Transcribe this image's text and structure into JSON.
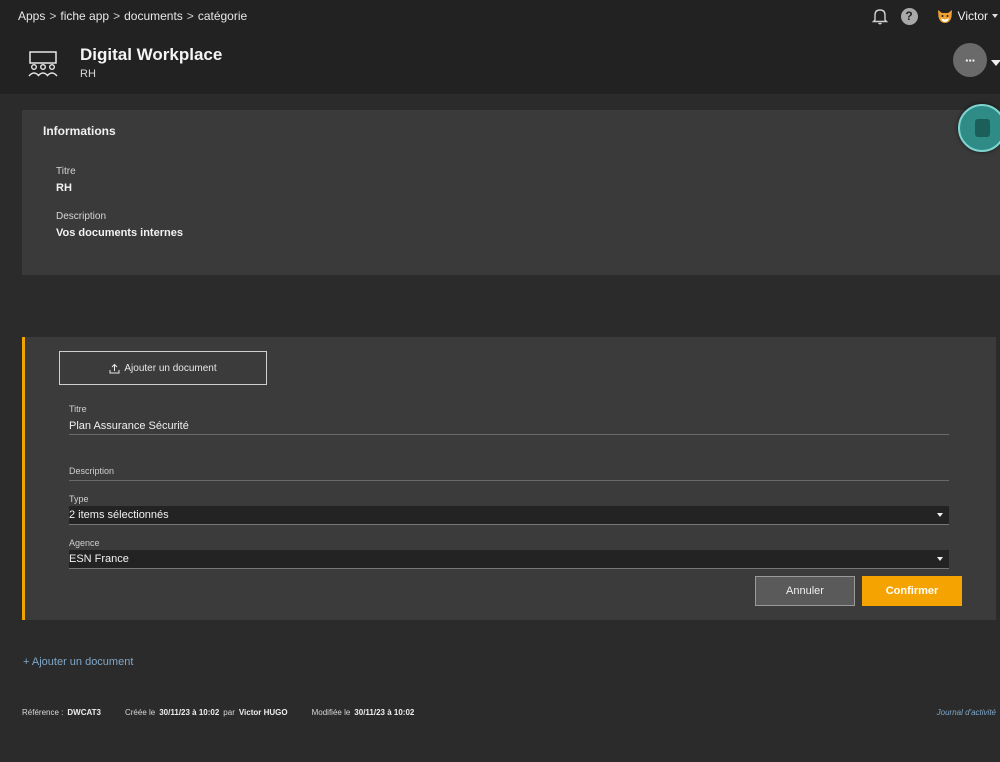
{
  "breadcrumb": [
    "Apps",
    "fiche app",
    "documents",
    "catégorie"
  ],
  "breadcrumb_sep": ">",
  "user": {
    "name": "Victor"
  },
  "help_label": "?",
  "app": {
    "title": "Digital Workplace",
    "subtitle": "RH"
  },
  "more_label": "···",
  "info": {
    "title": "Informations",
    "titre_label": "Titre",
    "titre_value": "RH",
    "description_label": "Description",
    "description_value": "Vos documents internes"
  },
  "form": {
    "add_document_label": "Ajouter un document",
    "titre_label": "Titre",
    "titre_value": "Plan Assurance Sécurité",
    "description_label": "Description",
    "description_value": "",
    "type_label": "Type",
    "type_value": "2 items sélectionnés",
    "agence_label": "Agence",
    "agence_value": "ESN France",
    "cancel_label": "Annuler",
    "confirm_label": "Confirmer"
  },
  "add_document_link": "+ Ajouter un document",
  "footer": {
    "reference_label": "Référence :",
    "reference_value": "DWCAT3",
    "created_label": "Créée le",
    "created_value": "30/11/23 à 10:02",
    "by_label": "par",
    "by_value": "Victor HUGO",
    "modified_label": "Modifiée le",
    "modified_value": "30/11/23 à 10:02",
    "journal_label": "Journal d'activité"
  },
  "colors": {
    "accent": "#f5a300",
    "link": "#7fa7c9",
    "teal": "#2e8b85"
  }
}
